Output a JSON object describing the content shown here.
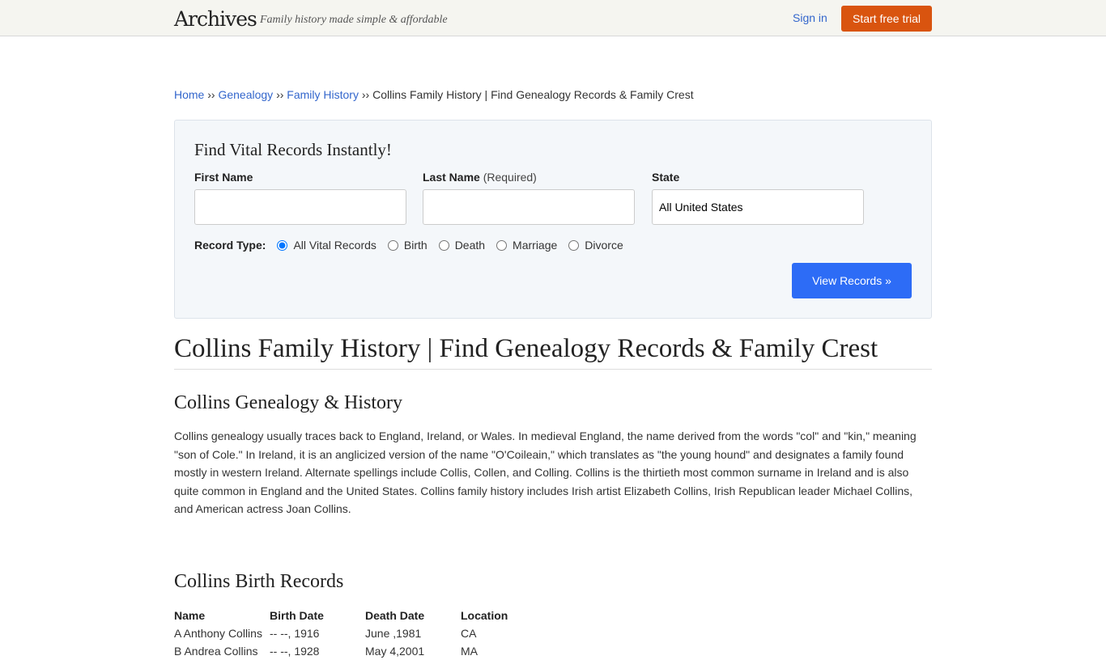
{
  "header": {
    "logo": "Archives",
    "tagline": "Family history made simple & affordable",
    "signin": "Sign in",
    "trial": "Start free trial"
  },
  "breadcrumb": {
    "items": [
      "Home",
      "Genealogy",
      "Family History"
    ],
    "sep": "››",
    "current": "Collins Family History | Find Genealogy Records & Family Crest"
  },
  "search": {
    "title": "Find Vital Records Instantly!",
    "first_label": "First Name",
    "last_label": "Last Name",
    "last_note": "(Required)",
    "state_label": "State",
    "state_value": "All United States",
    "record_type_label": "Record Type:",
    "record_types": [
      "All Vital Records",
      "Birth",
      "Death",
      "Marriage",
      "Divorce"
    ],
    "selected": "All Vital Records",
    "button": "View Records »"
  },
  "main": {
    "title": "Collins Family History | Find Genealogy Records & Family Crest",
    "section1": "Collins Genealogy & History",
    "para": "Collins genealogy usually traces back to England, Ireland, or Wales. In medieval England, the name derived from the words \"col\" and \"kin,\" meaning \"son of Cole.\" In Ireland, it is an anglicized version of the name \"O'Coileain,\" which translates as \"the young hound\" and designates a family found mostly in western Ireland. Alternate spellings include Collis, Collen, and Colling. Collins is the thirtieth most common surname in Ireland and is also quite common in England and the United States. Collins family history includes Irish artist Elizabeth Collins, Irish Republican leader Michael Collins, and American actress Joan Collins.",
    "section2": "Collins Birth Records"
  },
  "table": {
    "headers": [
      "Name",
      "Birth Date",
      "Death Date",
      "Location"
    ],
    "rows": [
      [
        "A Anthony Collins",
        "-- --, 1916",
        "June ,1981",
        "CA"
      ],
      [
        "B Andrea Collins",
        "-- --, 1928",
        "May 4,2001",
        "MA"
      ]
    ]
  }
}
